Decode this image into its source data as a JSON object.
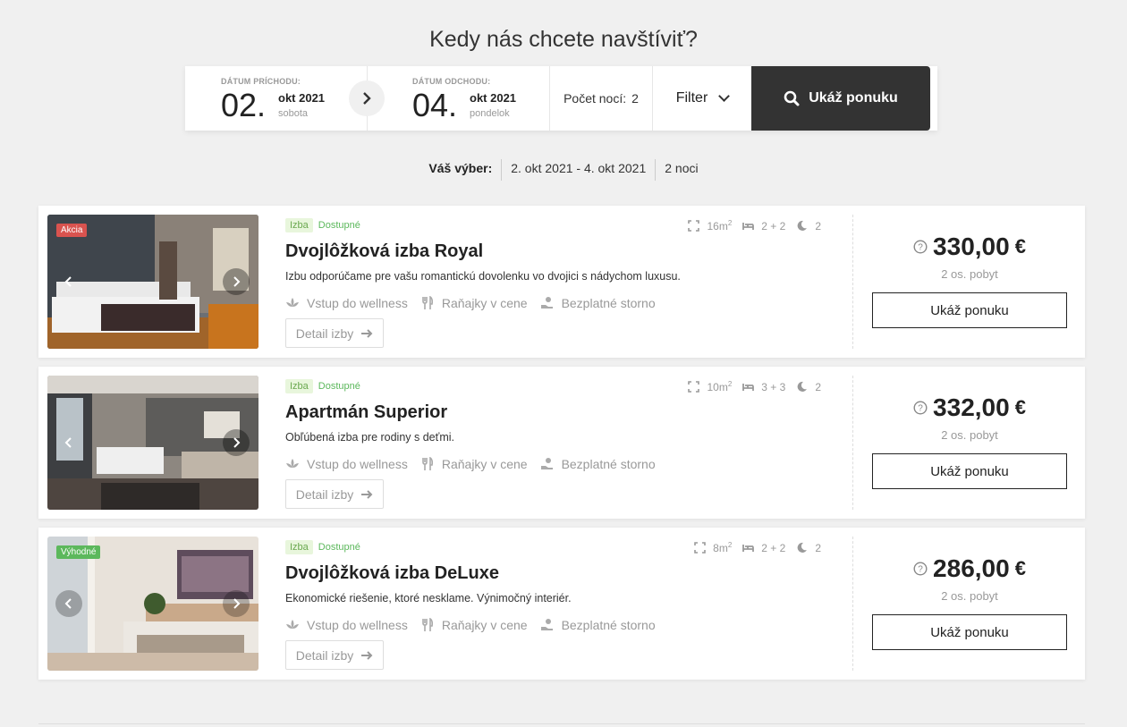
{
  "page": {
    "heading": "Kedy nás chcete navštíviť?"
  },
  "search": {
    "arrival": {
      "label": "DÁTUM PRÍCHODU:",
      "day": "02.",
      "month": "okt 2021",
      "weekday": "sobota"
    },
    "departure": {
      "label": "DÁTUM ODCHODU:",
      "day": "04.",
      "month": "okt 2021",
      "weekday": "pondelok"
    },
    "nights_label": "Počet nocí:",
    "nights_value": "2",
    "filter_label": "Filter",
    "button_label": "Ukáž ponuku"
  },
  "selection": {
    "label": "Váš výber:",
    "range": "2. okt 2021 - 4. okt 2021",
    "nights": "2 noci"
  },
  "rooms": [
    {
      "badge": "Akcia",
      "badge_color": "#d9534f",
      "type": "Izba",
      "status": "Dostupné",
      "area": "16m",
      "beds": "2 + 2",
      "nights": "2",
      "title": "Dvojlôžková izba Royal",
      "description": "Izbu odporúčame pre vašu romantickú dovolenku vo dvojici s nádychom luxusu.",
      "amenities": [
        "Vstup do wellness",
        "Raňajky v cene",
        "Bezplatné storno"
      ],
      "detail_label": "Detail izby",
      "price": "330,00",
      "currency": "€",
      "stay": "2 os. pobyt",
      "offer_label": "Ukáž ponuku"
    },
    {
      "badge": "",
      "badge_color": "",
      "type": "Izba",
      "status": "Dostupné",
      "area": "10m",
      "beds": "3 + 3",
      "nights": "2",
      "title": "Apartmán Superior",
      "description": "Obľúbená izba pre rodiny s deťmi.",
      "amenities": [
        "Vstup do wellness",
        "Raňajky v cene",
        "Bezplatné storno"
      ],
      "detail_label": "Detail izby",
      "price": "332,00",
      "currency": "€",
      "stay": "2 os. pobyt",
      "offer_label": "Ukáž ponuku"
    },
    {
      "badge": "Výhodné",
      "badge_color": "#5cb85c",
      "type": "Izba",
      "status": "Dostupné",
      "area": "8m",
      "beds": "2 + 2",
      "nights": "2",
      "title": "Dvojlôžková izba DeLuxe",
      "description": "Ekonomické riešenie, ktoré nesklame. Výnimočný interiér.",
      "amenities": [
        "Vstup do wellness",
        "Raňajky v cene",
        "Bezplatné storno"
      ],
      "detail_label": "Detail izby",
      "price": "286,00",
      "currency": "€",
      "stay": "2 os. pobyt",
      "offer_label": "Ukáž ponuku"
    }
  ],
  "colors": {
    "dark": "#333333",
    "accent_green": "#5cb85c",
    "sale_red": "#d9534f"
  }
}
